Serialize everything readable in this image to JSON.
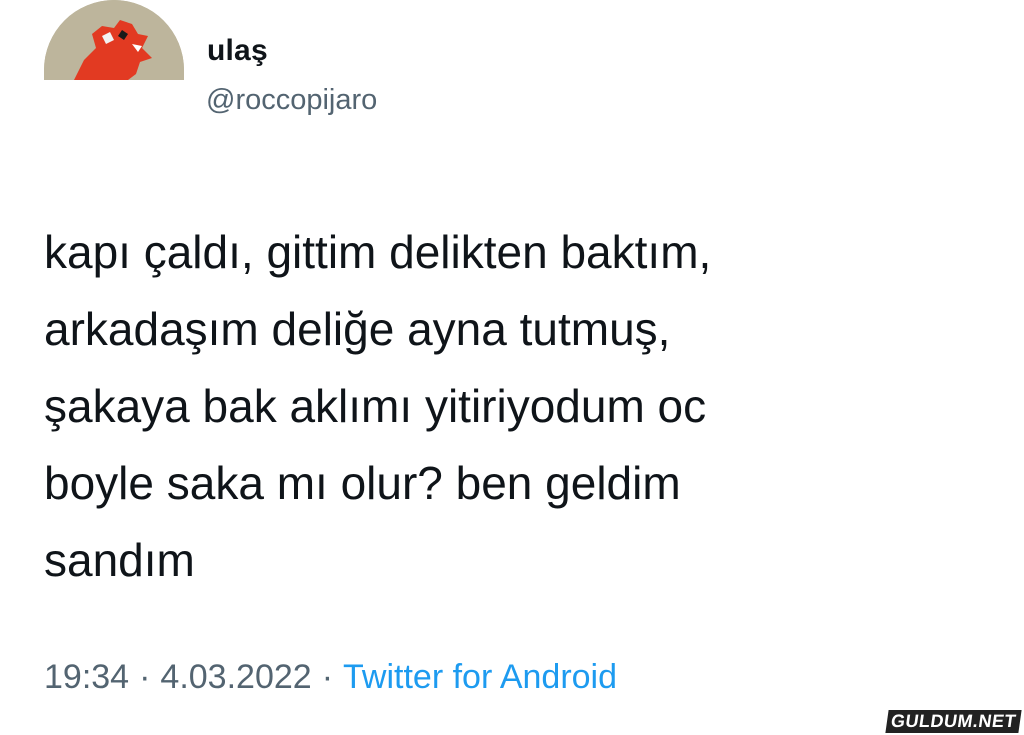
{
  "user": {
    "display_name": "ulaş",
    "username": "@roccopijaro",
    "avatar_icon": "avatar-red-figure"
  },
  "tweet": {
    "text": "kapı çaldı, gittim delikten baktım,\narkadaşım deliğe ayna tutmuş,\nşakaya bak aklımı yitiriyodum oc\nboyle saka mı olur? ben geldim\nsandım",
    "time": "19:34",
    "date": "4.03.2022",
    "separator": "·",
    "source": "Twitter for Android"
  },
  "watermark": {
    "text": "GULDUM.NET"
  },
  "colors": {
    "text": "#0f1419",
    "muted": "#536471",
    "link": "#1d9bf0",
    "background": "#ffffff"
  }
}
